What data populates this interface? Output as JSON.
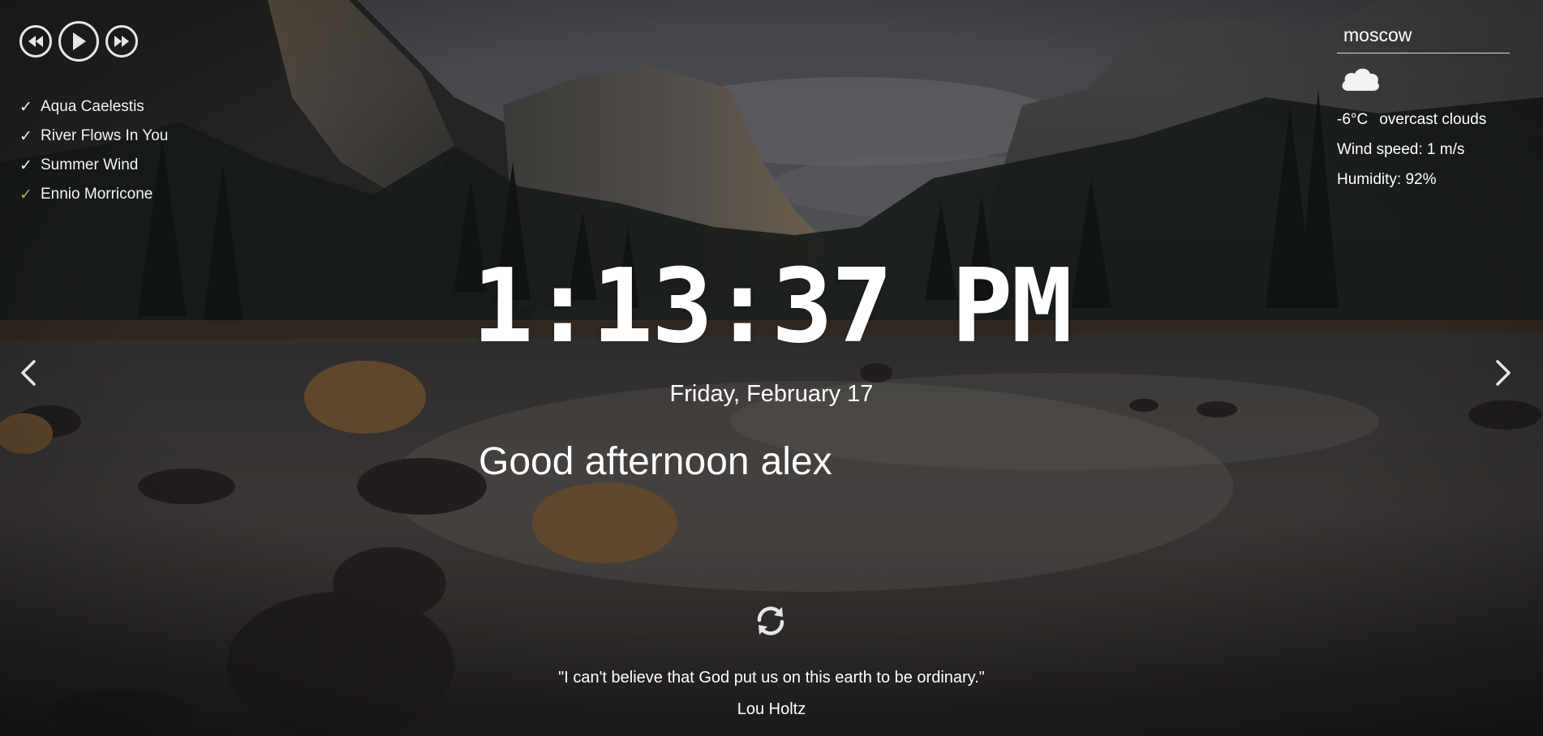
{
  "player": {
    "prev_icon": "rewind-icon",
    "play_icon": "play-icon",
    "next_icon": "fast-forward-icon",
    "playlist": [
      {
        "title": "Aqua Caelestis",
        "check": "✓"
      },
      {
        "title": "River Flows In You",
        "check": "✓"
      },
      {
        "title": "Summer Wind",
        "check": "✓"
      },
      {
        "title": "Ennio Morricone",
        "check": "✓"
      }
    ],
    "active_color": "#c9a24a"
  },
  "weather": {
    "city": "moscow",
    "icon": "cloud-icon",
    "temperature": "-6°C",
    "description": "overcast clouds",
    "wind": "Wind speed: 1 m/s",
    "humidity": "Humidity: 92%"
  },
  "clock": {
    "time": "1:13:37 PM",
    "date": "Friday, February 17"
  },
  "greeting": {
    "text": "Good afternoon",
    "name": "alex"
  },
  "navigation": {
    "prev_icon": "chevron-left-icon",
    "next_icon": "chevron-right-icon"
  },
  "quote": {
    "refresh_icon": "refresh-icon",
    "text": "\"I can't believe that God put us on this earth to be ordinary.\"",
    "author": "Lou Holtz"
  }
}
